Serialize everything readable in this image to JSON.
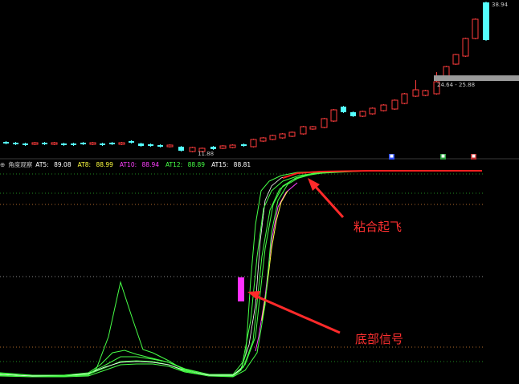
{
  "colors": {
    "background": "#000000",
    "candle_up": "#ff3c3c",
    "candle_down": "#54ffff",
    "indicator_green": "#46ff46",
    "indicator_white": "#ffffff",
    "indicator_yellow": "#ffff40",
    "indicator_magenta": "#ff40ff",
    "annotation_red": "#ff2a2a",
    "dotted_green": "#1f8a1f",
    "dotted_orange": "#b06a2a",
    "dotted_gray": "#8a8a8a"
  },
  "price_panel": {
    "high_label": "38.94",
    "range_label": "24.64 - 25.88",
    "low_label": "11.88",
    "event_icons": [
      "mail-icon",
      "bonus-icon",
      "info-icon"
    ]
  },
  "indicator_panel": {
    "name": "角度观察",
    "values": [
      {
        "label": "AT5:",
        "value": "89.08",
        "color": "#ffffff"
      },
      {
        "label": "AT8:",
        "value": "88.99",
        "color": "#ffff40"
      },
      {
        "label": "AT10:",
        "value": "88.94",
        "color": "#ff40ff"
      },
      {
        "label": "AT12:",
        "value": "88.89",
        "color": "#46ff46"
      },
      {
        "label": "AT15:",
        "value": "88.81",
        "color": "#ffffff"
      }
    ]
  },
  "annotations": {
    "takeoff_label": "粘合起飞",
    "bottom_signal_label": "底部信号"
  }
}
